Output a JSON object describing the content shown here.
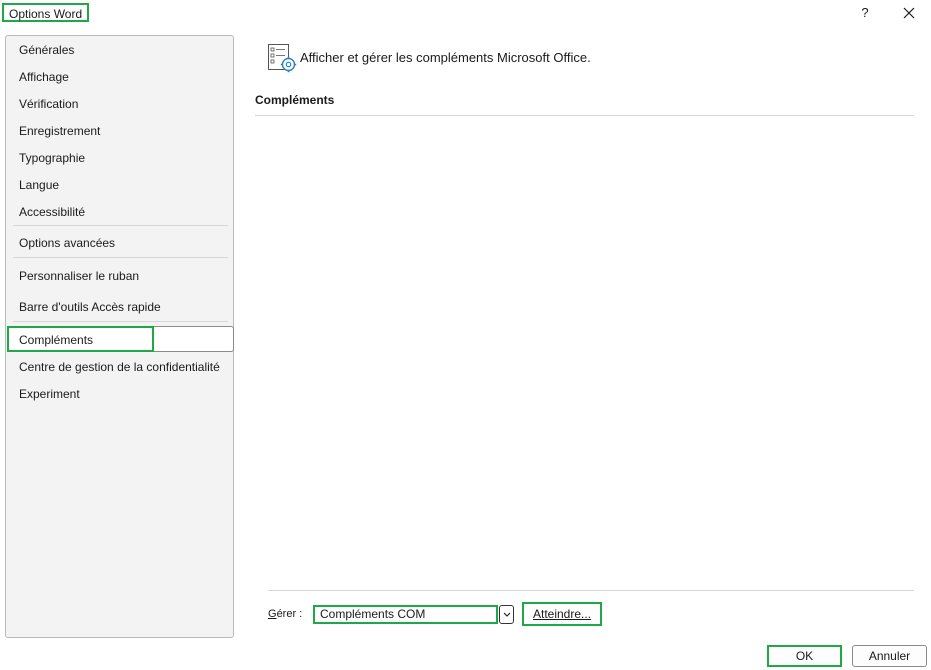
{
  "window": {
    "title": "Options Word",
    "help_label": "?",
    "close_label": "✕"
  },
  "sidebar": {
    "items": [
      {
        "label": "Générales"
      },
      {
        "label": "Affichage"
      },
      {
        "label": "Vérification"
      },
      {
        "label": "Enregistrement"
      },
      {
        "label": "Typographie"
      },
      {
        "label": "Langue"
      },
      {
        "label": "Accessibilité"
      },
      {
        "label": "Options avancées"
      },
      {
        "label": "Personnaliser le ruban"
      },
      {
        "label": "Barre d'outils Accès rapide"
      },
      {
        "label": "Compléments"
      },
      {
        "label": "Centre de gestion de la confidentialité"
      },
      {
        "label": "Experiment"
      }
    ],
    "selected": "Compléments"
  },
  "main": {
    "header_icon": "addins-settings-icon",
    "header_text": "Afficher et gérer les compléments Microsoft Office.",
    "section_title": "Compléments"
  },
  "manage": {
    "label_prefix": "G",
    "label_rest": "érer :",
    "selected_value": "Compléments COM",
    "dropdown_icon": "chevron-down-icon",
    "go_label_prefix": "A",
    "go_label_rest": "tteindre..."
  },
  "footer": {
    "ok_label": "OK",
    "cancel_label": "Annuler"
  },
  "colors": {
    "highlight": "#1fa845",
    "sidebar_bg": "#f3f3f3"
  }
}
